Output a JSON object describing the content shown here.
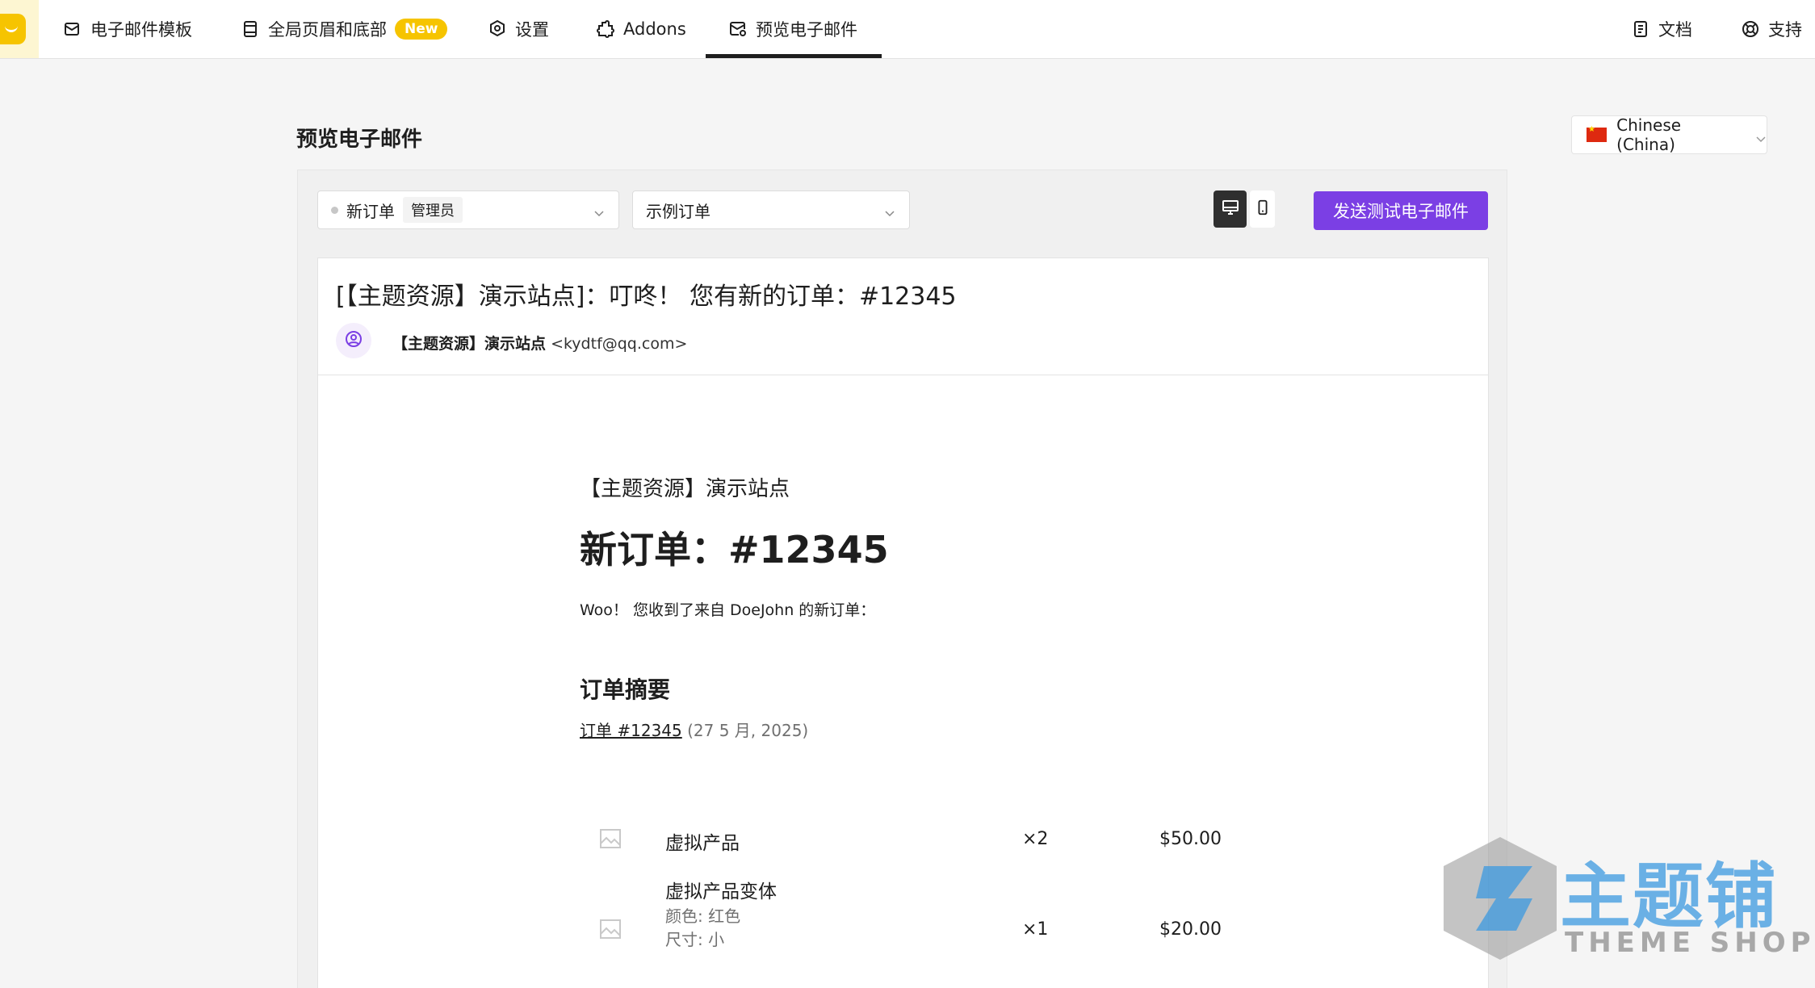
{
  "nav": {
    "items": [
      {
        "label": "电子邮件模板",
        "icon": "mail-edit-icon"
      },
      {
        "label": "全局页眉和底部",
        "icon": "layout-icon",
        "badge": "New"
      },
      {
        "label": "设置",
        "icon": "settings-icon"
      },
      {
        "label": "Addons",
        "icon": "puzzle-icon"
      },
      {
        "label": "预览电子邮件",
        "icon": "mail-preview-icon",
        "active": true
      }
    ],
    "right": [
      {
        "label": "文档",
        "icon": "document-icon"
      },
      {
        "label": "支持",
        "icon": "lifebuoy-icon"
      }
    ]
  },
  "page": {
    "title": "预览电子邮件",
    "language": "Chinese (China)"
  },
  "toolbar": {
    "email_type": "新订单",
    "recipient_role": "管理员",
    "order_select": "示例订单",
    "send_button": "发送测试电子邮件",
    "view_modes": [
      "desktop-icon",
      "mobile-icon"
    ]
  },
  "email": {
    "subject": "[【主题资源】演示站点]：叮咚！ 您有新的订单：#12345",
    "sender_name": "【主题资源】演示站点",
    "sender_email": "<kydtf@qq.com>",
    "site_name": "【主题资源】演示站点",
    "heading": "新订单：#12345",
    "intro": "Woo！ 您收到了来自 DoeJohn 的新订单：",
    "summary_title": "订单摘要",
    "order_link": "订单 #12345",
    "order_date": "(27 5 月, 2025)",
    "items": [
      {
        "name": "虚拟产品",
        "meta": [],
        "qty": "×2",
        "price": "$50.00"
      },
      {
        "name": "虚拟产品变体",
        "meta": [
          "颜色: 红色",
          "尺寸: 小"
        ],
        "qty": "×1",
        "price": "$20.00"
      }
    ]
  },
  "watermark": {
    "text_cn": "主题铺",
    "text_en": "THEME SHOP"
  },
  "colors": {
    "accent": "#7b3fe4",
    "brand": "#f6c400",
    "background": "#f5f5f5"
  }
}
